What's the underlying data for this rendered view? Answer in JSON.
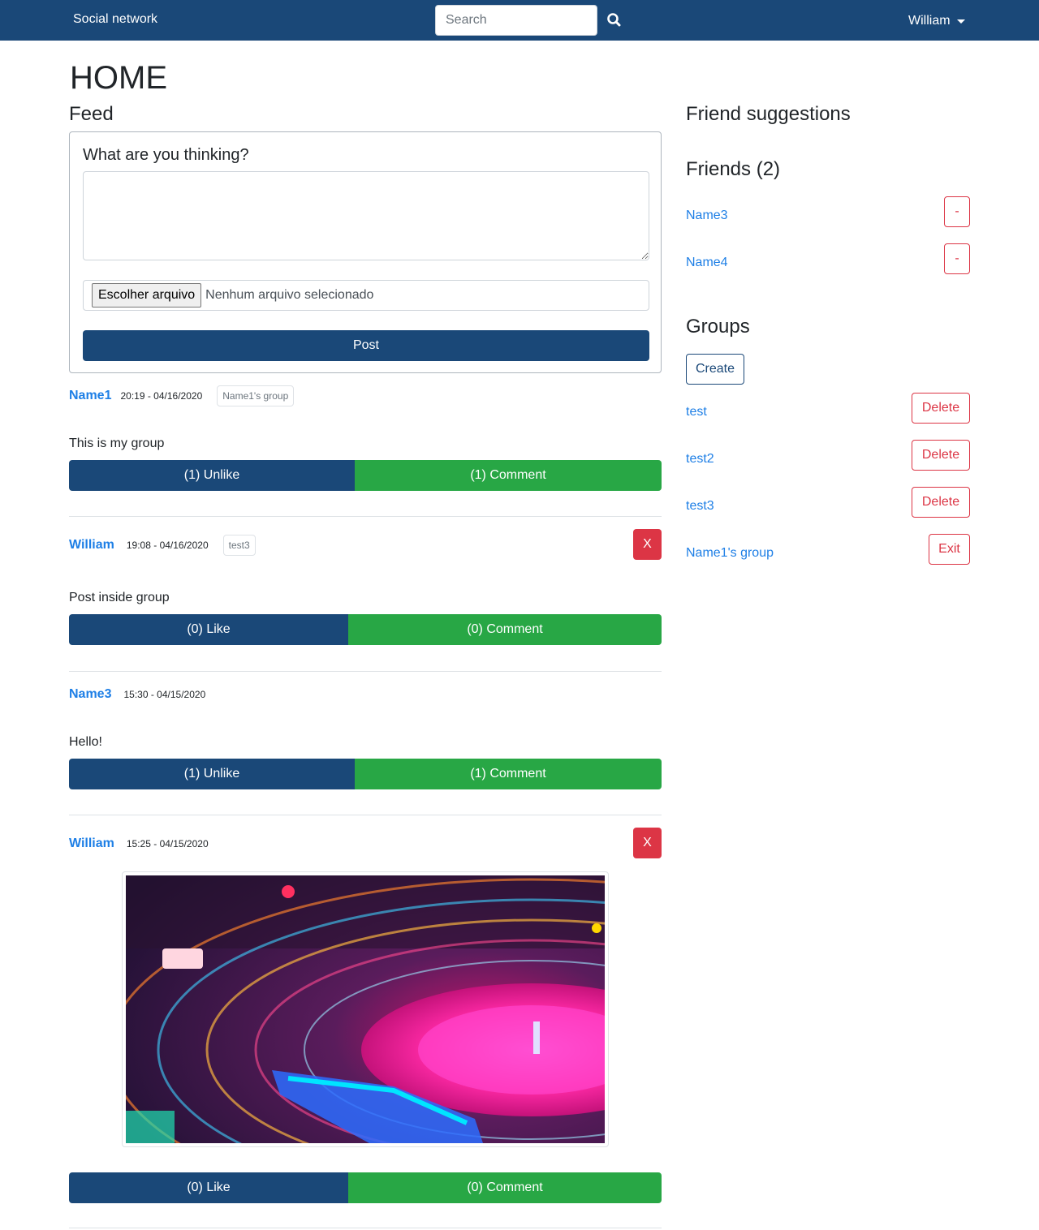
{
  "navbar": {
    "brand": "Social network",
    "search_placeholder": "Search",
    "search_icon": "search-icon",
    "user": "William"
  },
  "page_title": "HOME",
  "feed": {
    "title": "Feed",
    "compose": {
      "label": "What are you thinking?",
      "text_value": "",
      "file_button": "Escolher arquivo",
      "file_status": "Nenhum arquivo selecionado",
      "post_button": "Post"
    },
    "posts": [
      {
        "author": "Name1",
        "time": "20:19 - 04/16/2020",
        "group": "Name1's group",
        "text": "This is my group",
        "like_label": "(1) Unlike",
        "comment_label": "(1) Comment",
        "deletable": false
      },
      {
        "author": "William",
        "time": "19:08 - 04/16/2020",
        "group": "test3",
        "text": "Post inside group",
        "like_label": "(0) Like",
        "comment_label": "(0) Comment",
        "deletable": true,
        "delete_label": "X"
      },
      {
        "author": "Name3",
        "time": "15:30 - 04/15/2020",
        "group": "",
        "text": "Hello!",
        "like_label": "(1) Unlike",
        "comment_label": "(1) Comment",
        "deletable": false
      },
      {
        "author": "William",
        "time": "15:25 - 04/15/2020",
        "group": "",
        "text": "",
        "has_image": true,
        "like_label": "(0) Like",
        "comment_label": "(0) Comment",
        "deletable": true,
        "delete_label": "X"
      }
    ]
  },
  "sidebar": {
    "suggestions_title": "Friend suggestions",
    "friends_title": "Friends (2)",
    "friends": [
      {
        "name": "Name3",
        "remove_label": "-"
      },
      {
        "name": "Name4",
        "remove_label": "-"
      }
    ],
    "groups_title": "Groups",
    "create_label": "Create",
    "groups": [
      {
        "name": "test",
        "action": "Delete"
      },
      {
        "name": "test2",
        "action": "Delete"
      },
      {
        "name": "test3",
        "action": "Delete"
      },
      {
        "name": "Name1's group",
        "action": "Exit"
      }
    ]
  },
  "colors": {
    "primary": "#1a4878",
    "success": "#28a745",
    "danger": "#dc3545",
    "link": "#1e7fe6"
  }
}
